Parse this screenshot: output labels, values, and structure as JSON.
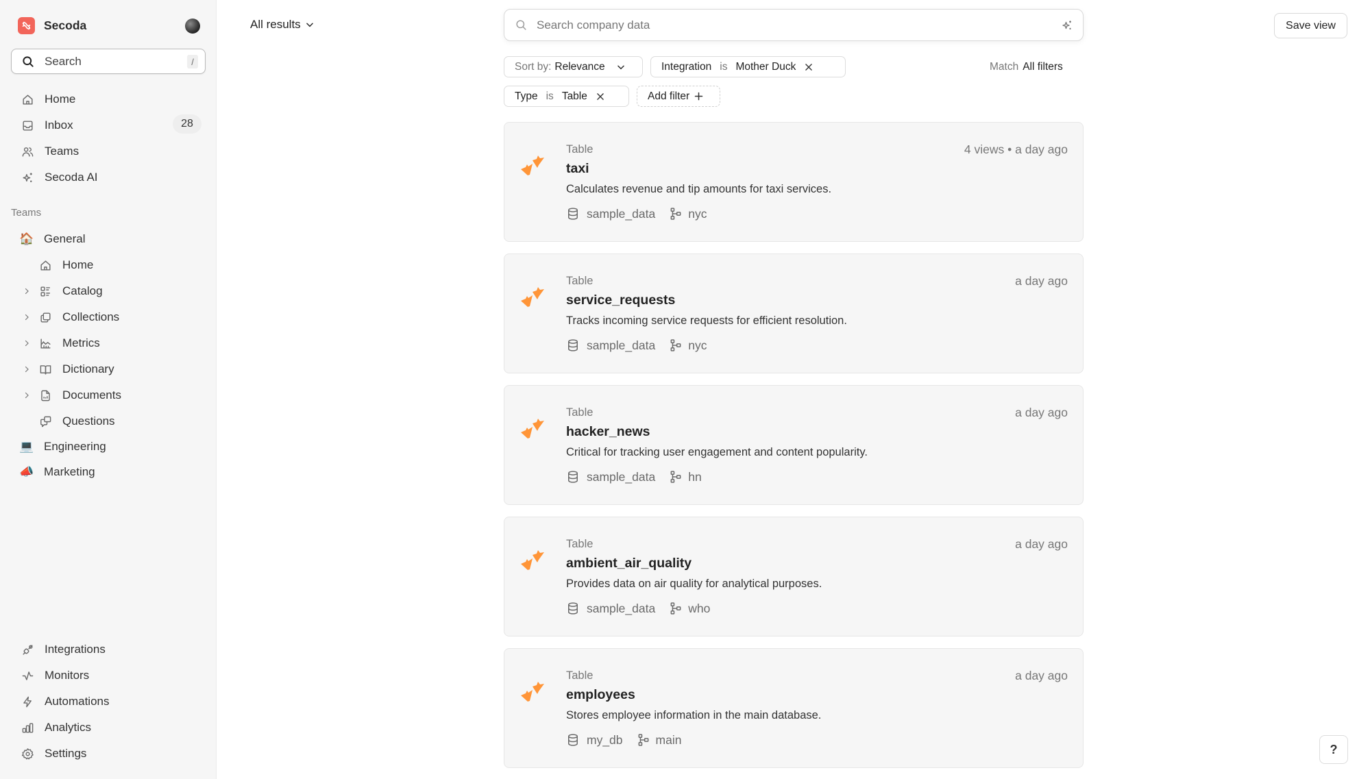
{
  "sidebar": {
    "brand": "Secoda",
    "search": {
      "label": "Search",
      "shortcut": "/"
    },
    "nav": [
      {
        "label": "Home",
        "icon": "home-icon"
      },
      {
        "label": "Inbox",
        "icon": "inbox-icon",
        "badge": "28"
      },
      {
        "label": "Teams",
        "icon": "users-icon"
      },
      {
        "label": "Secoda AI",
        "icon": "sparkles-icon"
      }
    ],
    "teams_label": "Teams",
    "teams": [
      {
        "label": "General",
        "emoji": "🏠",
        "children": [
          {
            "label": "Home",
            "icon": "home-icon",
            "expandable": false
          },
          {
            "label": "Catalog",
            "icon": "catalog-icon",
            "expandable": true
          },
          {
            "label": "Collections",
            "icon": "collections-icon",
            "expandable": true
          },
          {
            "label": "Metrics",
            "icon": "metrics-icon",
            "expandable": true
          },
          {
            "label": "Dictionary",
            "icon": "book-icon",
            "expandable": true
          },
          {
            "label": "Documents",
            "icon": "document-icon",
            "expandable": true
          },
          {
            "label": "Questions",
            "icon": "questions-icon",
            "expandable": false
          }
        ]
      },
      {
        "label": "Engineering",
        "emoji": "💻"
      },
      {
        "label": "Marketing",
        "emoji": "📣"
      }
    ],
    "bottom_nav": [
      {
        "label": "Integrations",
        "icon": "plug-icon"
      },
      {
        "label": "Monitors",
        "icon": "pulse-icon"
      },
      {
        "label": "Automations",
        "icon": "bolt-icon"
      },
      {
        "label": "Analytics",
        "icon": "bar-chart-icon"
      },
      {
        "label": "Settings",
        "icon": "gear-icon"
      }
    ]
  },
  "header": {
    "view_selector": "All results",
    "search_placeholder": "Search company data",
    "search_value": "",
    "save_view": "Save view"
  },
  "filters": {
    "sort": {
      "label": "Sort by:",
      "value": "Relevance"
    },
    "active": [
      {
        "field": "Integration",
        "op": "is",
        "value": "Mother Duck"
      },
      {
        "field": "Type",
        "op": "is",
        "value": "Table"
      }
    ],
    "add_filter": "Add filter",
    "match": {
      "label": "Match",
      "value": "All filters"
    }
  },
  "results": [
    {
      "type": "Table",
      "title": "taxi",
      "description": "Calculates revenue and tip amounts for taxi services.",
      "database": "sample_data",
      "schema": "nyc",
      "stats": "4 views • a day ago"
    },
    {
      "type": "Table",
      "title": "service_requests",
      "description": "Tracks incoming service requests for efficient resolution.",
      "database": "sample_data",
      "schema": "nyc",
      "stats": "a day ago"
    },
    {
      "type": "Table",
      "title": "hacker_news",
      "description": "Critical for tracking user engagement and content popularity.",
      "database": "sample_data",
      "schema": "hn",
      "stats": "a day ago"
    },
    {
      "type": "Table",
      "title": "ambient_air_quality",
      "description": "Provides data on air quality for analytical purposes.",
      "database": "sample_data",
      "schema": "who",
      "stats": "a day ago"
    },
    {
      "type": "Table",
      "title": "employees",
      "description": "Stores employee information in the main database.",
      "database": "my_db",
      "schema": "main",
      "stats": "a day ago"
    }
  ],
  "help_label": "?",
  "colors": {
    "brand": "#f2655a",
    "motherduck": "#ff9538",
    "card_bg": "#f6f6f6",
    "sidebar_bg": "#f6f6f6"
  }
}
